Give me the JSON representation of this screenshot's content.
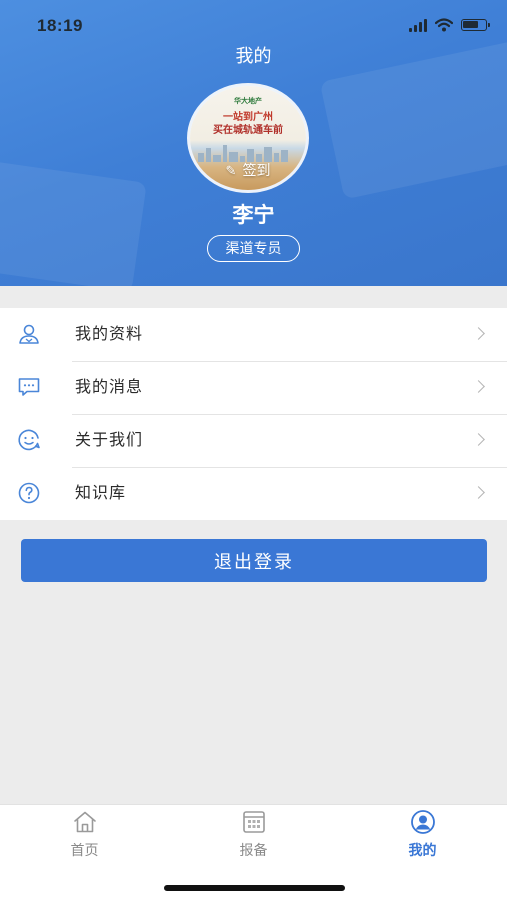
{
  "status_bar": {
    "time": "18:19",
    "battery_level": 0.75
  },
  "header": {
    "title": "我的",
    "avatar": {
      "poster_lines": [
        "华大地产",
        "一站到广州",
        "买在城轨通车前"
      ],
      "checkin_label": "签到",
      "checkin_icon": "pen-icon"
    },
    "user_name": "李宁",
    "role": "渠道专员"
  },
  "menu": {
    "items": [
      {
        "label": "我的资料",
        "icon": "user-profile-icon"
      },
      {
        "label": "我的消息",
        "icon": "message-icon"
      },
      {
        "label": "关于我们",
        "icon": "smile-icon"
      },
      {
        "label": "知识库",
        "icon": "question-icon"
      }
    ]
  },
  "logout": {
    "label": "退出登录"
  },
  "tabbar": {
    "tabs": [
      {
        "label": "首页",
        "icon": "home-icon",
        "active": false
      },
      {
        "label": "报备",
        "icon": "report-icon",
        "active": false
      },
      {
        "label": "我的",
        "icon": "profile-icon",
        "active": true
      }
    ]
  },
  "colors": {
    "header_blue": "#3f7fd6",
    "accent": "#3a77d5",
    "icon_blue": "#4a86d8",
    "inactive_gray": "#8a8a8a",
    "background": "#ececec"
  }
}
